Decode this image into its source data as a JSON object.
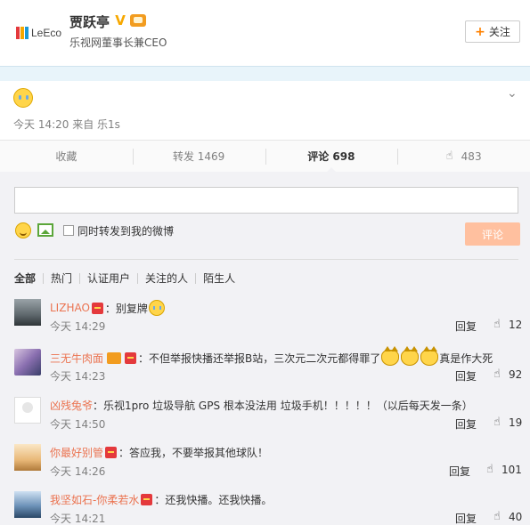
{
  "header": {
    "logo_text": "LeEco",
    "user_name": "贾跃亭",
    "verified_mark": "V",
    "user_title": "乐视网董事长兼CEO",
    "follow_label": "关注"
  },
  "post": {
    "emoji_icon": "crying-emoji-icon",
    "meta": "今天 14:20 来自 乐1s"
  },
  "actions": {
    "favorite": "收藏",
    "repost": "转发 1469",
    "comment": "评论 698",
    "like_count": "483"
  },
  "composer": {
    "placeholder": "",
    "also_repost_label": "同时转发到我的微博",
    "submit_label": "评论"
  },
  "filters": [
    "全部",
    "热门",
    "认证用户",
    "关注的人",
    "陌生人"
  ],
  "comments": [
    {
      "user": "LIZHAO",
      "text": "：别复牌",
      "time": "今天 14:29",
      "reply": "回复",
      "likes": "12"
    },
    {
      "user": "三无牛肉面",
      "text": "：不但举报快播还举报B站，三次元二次元都得罪了",
      "text_after": "真是作大死",
      "time": "今天 14:23",
      "reply": "回复",
      "likes": "92"
    },
    {
      "user": "凶残兔爷",
      "text": "：乐视1pro 垃圾导航 GPS 根本没法用 垃圾手机！！！！！（以后每天发一条）",
      "time": "今天 14:50",
      "reply": "回复",
      "likes": "19"
    },
    {
      "user": "你最好别管",
      "text": "：答应我，不要举报其他球队！",
      "time": "今天 14:26",
      "reply": "回复",
      "likes": "101"
    },
    {
      "user": "我坚如石-你柔若水",
      "text": "：还我快播。还我快播。",
      "time": "今天 14:21",
      "reply": "回复",
      "likes": "40"
    }
  ],
  "colors": {
    "accent_orange": "#ff8200",
    "username_link": "#eb7350",
    "submit_disabled": "#ffc09f",
    "panel_bg": "#f2f2f5"
  }
}
